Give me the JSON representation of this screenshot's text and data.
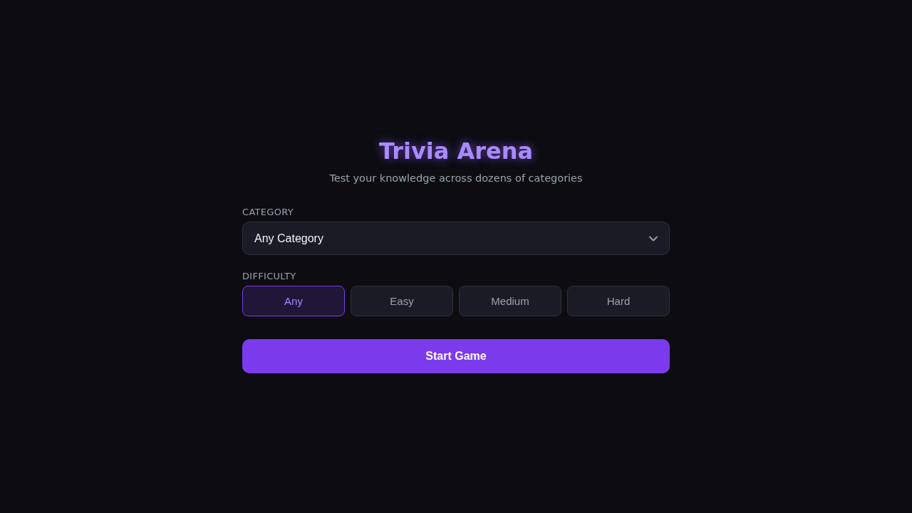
{
  "header": {
    "title": "Trivia Arena",
    "subtitle": "Test your knowledge across dozens of categories"
  },
  "category": {
    "label": "CATEGORY",
    "value": "Any Category"
  },
  "difficulty": {
    "label": "DIFFICULTY",
    "options": [
      {
        "label": "Any",
        "selected": true
      },
      {
        "label": "Easy",
        "selected": false
      },
      {
        "label": "Medium",
        "selected": false
      },
      {
        "label": "Hard",
        "selected": false
      }
    ]
  },
  "start_button": {
    "label": "Start Game"
  }
}
